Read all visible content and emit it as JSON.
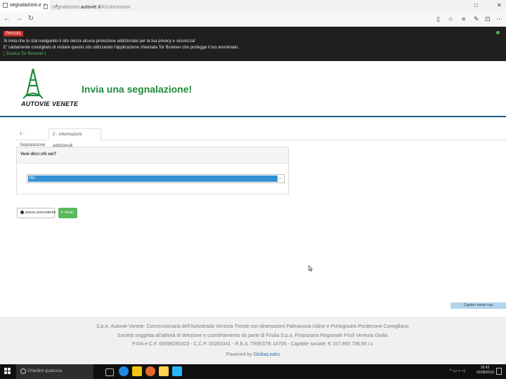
{
  "browser": {
    "tab_title": "segnalazioni.autovie.it",
    "tab_close": "×",
    "new_tab": "+",
    "window_controls": [
      "□",
      "✕"
    ],
    "address": {
      "prefix": "segnalazioni.",
      "domain": "autovie.it",
      "path": "/#/submission"
    },
    "nav_back": "←",
    "nav_forward": "→",
    "nav_refresh": "↻"
  },
  "warning": {
    "badge": "Pericolo",
    "line1": "Si invia che tu stai navigando il sito senza alcuna protezione addizionale per la tua privacy e sicurezza!",
    "line2": "E' caldamente consigliato di visitare questo sito utilizzando l'applicazione chiamata Tor Browser che protegge il tuo anonimato.",
    "link": "[ Scarica Tor Browser ]"
  },
  "header": {
    "logo_text": "AUTOVIE VENETE",
    "title": "Invia una segnalazione!"
  },
  "steps": [
    {
      "label": "1 - Segnalazione"
    },
    {
      "label": "2 - Informazioni addizionali"
    }
  ],
  "form": {
    "question": "Vuoi dirci chi sei?",
    "selected": "No",
    "caret": "⌄"
  },
  "buttons": {
    "prev": "passo precedente",
    "send": "✔ Invia"
  },
  "feedback": "Capitorr mentr nua",
  "footer": {
    "line1": "S.p.A. Autovie Venete: Concessionaria dell'Autostrada Venezia Trieste con diramazioni Palmanova Udine e Portogruaro Pordenone Conegliano.",
    "line2": "Società soggetta all'attività di direzione e coordinamento da parte di Friulia S.p.a. Finanziaria Regionale Friuli Venezia Giulia.",
    "line3": "P.IVA e C.F. 00098290323 - C.C.P. 00283341 - R.E.A. TRIESTE 14705 - Capitale sociale: € 157.965.738,58 i.v.",
    "powered_prefix": "Powered by ",
    "powered_name": "GlobaLeaks"
  },
  "taskbar": {
    "search_placeholder": "Chiedimi qualcosa",
    "clock_time": "16:43",
    "clock_date": "02/08/2016",
    "tray": "^ ▭ ⌁ ◁"
  },
  "colors": {
    "accent_green": "#1f8a3b",
    "select_blue": "#3392d4",
    "button_green": "#5cb85c",
    "warning_red": "#c9302c",
    "header_rule": "#1f5c8a"
  }
}
